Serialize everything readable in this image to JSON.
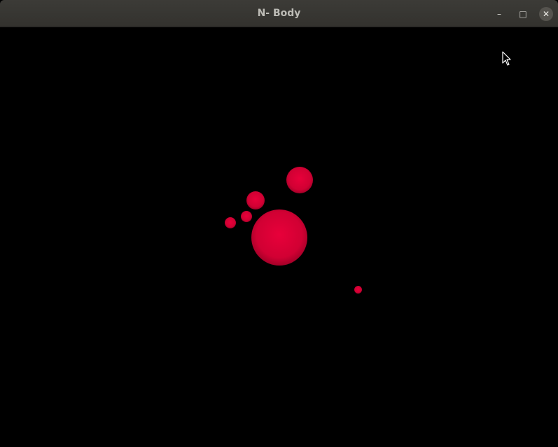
{
  "window": {
    "title": "N- Body",
    "minimize_glyph": "–",
    "maximize_glyph": "□",
    "close_glyph": "✕"
  },
  "scene": {
    "background": "#000000",
    "body_color": "#d6003a",
    "body_count": 6
  },
  "icons": {
    "cursor": "mouse-pointer-icon"
  }
}
